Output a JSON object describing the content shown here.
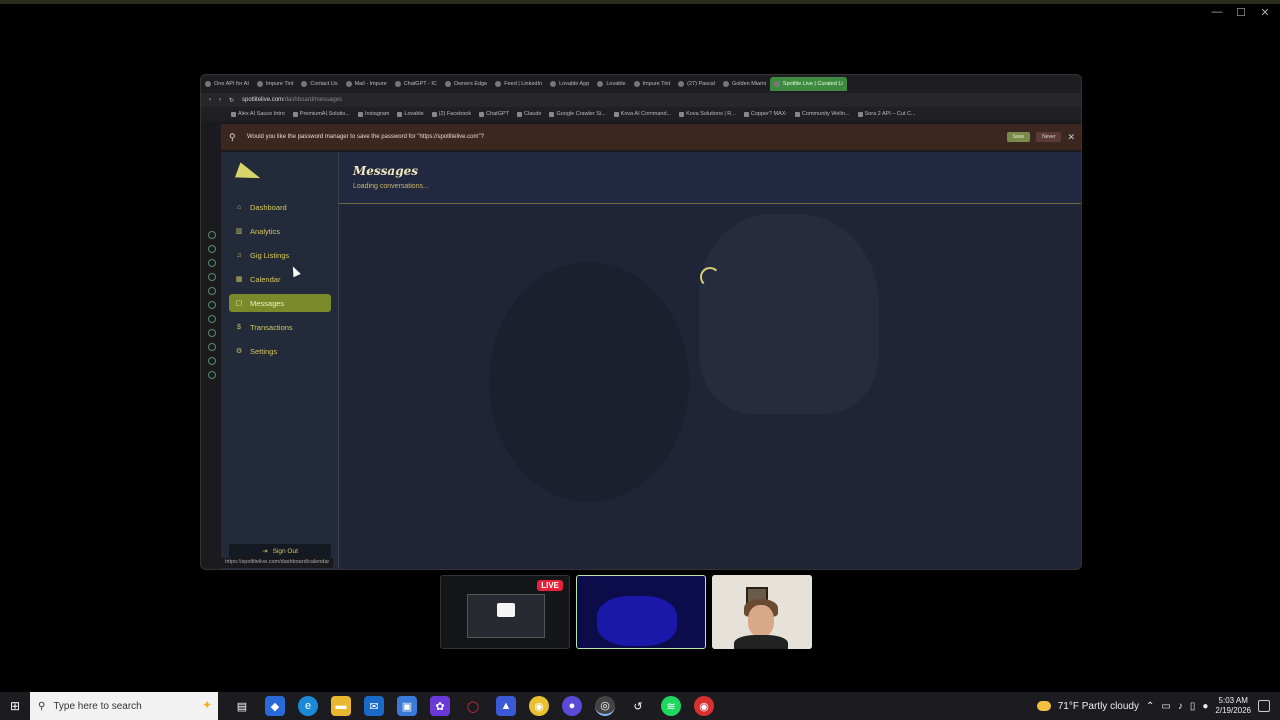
{
  "outer_controls": [
    "—",
    "☐",
    "✕"
  ],
  "browser": {
    "tabs": [
      {
        "label": "One API for AI"
      },
      {
        "label": "Impure Tint"
      },
      {
        "label": "Contact Us"
      },
      {
        "label": "Mail - Impure"
      },
      {
        "label": "ChatGPT - IC"
      },
      {
        "label": "Owners Edge"
      },
      {
        "label": "Feed | LinkedIn"
      },
      {
        "label": "Lovable App"
      },
      {
        "label": "Lovable"
      },
      {
        "label": "Impure Tint"
      },
      {
        "label": "(27) Pascal"
      },
      {
        "label": "Golden Miami"
      },
      {
        "label": "Spotlite Live | Curated Li",
        "active": true
      }
    ],
    "url_host": "spotlitelive.com",
    "url_path": "/dashboard/messages",
    "bookmarks": [
      "Alex AI Sauce Intro",
      "PremiumAI.Solutio...",
      "Instagram",
      "Lovable",
      "(2) Facebook",
      "ChatGPT",
      "Claude",
      "Google Crawler Si...",
      "Kova AI Command...",
      "Kova Solutions | R...",
      "Copper? MAX:",
      "Community Welln...",
      "Sora 2 API – Cut C..."
    ],
    "password_prompt": {
      "text": "Would you like the password manager to save the password for \"https://spotlitelive.com\"?",
      "save_label": "Save",
      "never_label": "Never",
      "close_label": "✕"
    },
    "status_url": "https://spotlitelive.com/dashboard/calendar"
  },
  "sidebar": {
    "items": [
      {
        "label": "Dashboard",
        "icon": "⌂",
        "icon_name": "home-icon"
      },
      {
        "label": "Analytics",
        "icon": "▥",
        "icon_name": "bar-chart-icon"
      },
      {
        "label": "Gig Listings",
        "icon": "♫",
        "icon_name": "music-note-icon"
      },
      {
        "label": "Calendar",
        "icon": "▦",
        "icon_name": "calendar-icon"
      },
      {
        "label": "Messages",
        "icon": "▢",
        "icon_name": "message-icon",
        "active": true
      },
      {
        "label": "Transactions",
        "icon": "$",
        "icon_name": "dollar-icon"
      },
      {
        "label": "Settings",
        "icon": "⚙",
        "icon_name": "gear-icon"
      }
    ],
    "sign_out_label": "Sign Out",
    "sign_out_icon": "⇥"
  },
  "main": {
    "title": "Messages",
    "subtitle": "Loading conversations..."
  },
  "stream_overlay": {
    "live_badge": "LIVE"
  },
  "taskbar": {
    "search_placeholder": "Type here to search",
    "weather": "71°F  Partly cloudy",
    "time": "5:03 AM",
    "date": "2/19/2026"
  },
  "colors": {
    "accent": "#d6c85a",
    "active_nav": "#7a8a2a",
    "sidebar_bg": "#232a3a",
    "main_bg": "#1f2437",
    "live_red": "#e8203a"
  }
}
